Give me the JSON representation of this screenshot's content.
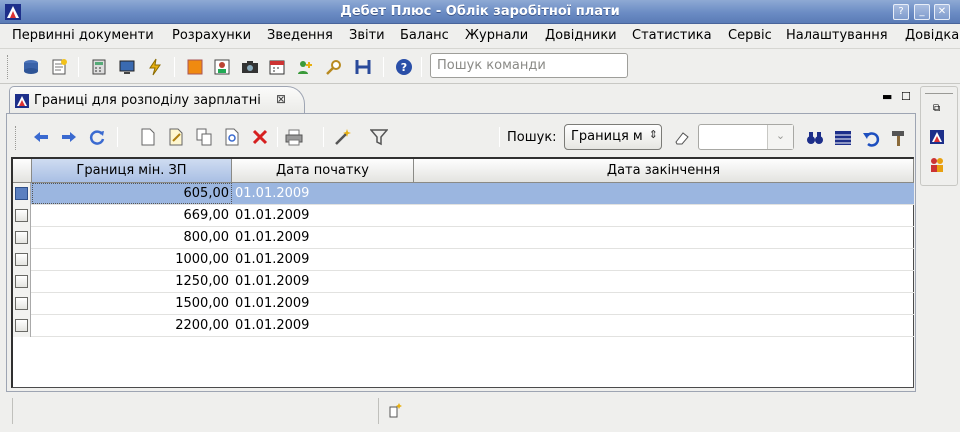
{
  "window": {
    "title": "Дебет Плюс - Облік заробітної плати"
  },
  "menu": [
    "Первинні документи",
    "Розрахунки",
    "Зведення",
    "Звіти",
    "Баланс",
    "Журнали",
    "Довідники",
    "Статистика",
    "Сервіс",
    "Налаштування",
    "Довідка"
  ],
  "command_search": {
    "placeholder": "Пошук команди"
  },
  "tab": {
    "label": "Границі для розподілу зарплатні",
    "close": "⊠"
  },
  "search": {
    "label": "Пошук:",
    "field": "Границя м"
  },
  "table": {
    "columns": [
      "Границя мін. ЗП",
      "Дата початку",
      "Дата закінчення"
    ],
    "rows": [
      {
        "min": "605,00",
        "start": "01.01.2009",
        "end": ""
      },
      {
        "min": "669,00",
        "start": "01.01.2009",
        "end": ""
      },
      {
        "min": "800,00",
        "start": "01.01.2009",
        "end": ""
      },
      {
        "min": "1000,00",
        "start": "01.01.2009",
        "end": ""
      },
      {
        "min": "1250,00",
        "start": "01.01.2009",
        "end": ""
      },
      {
        "min": "1500,00",
        "start": "01.01.2009",
        "end": ""
      },
      {
        "min": "2200,00",
        "start": "01.01.2009",
        "end": ""
      }
    ]
  },
  "colors": {
    "title_bar": "#6b8cc4",
    "selected_row": "#9bb6e0",
    "delete_icon": "#d62020"
  }
}
